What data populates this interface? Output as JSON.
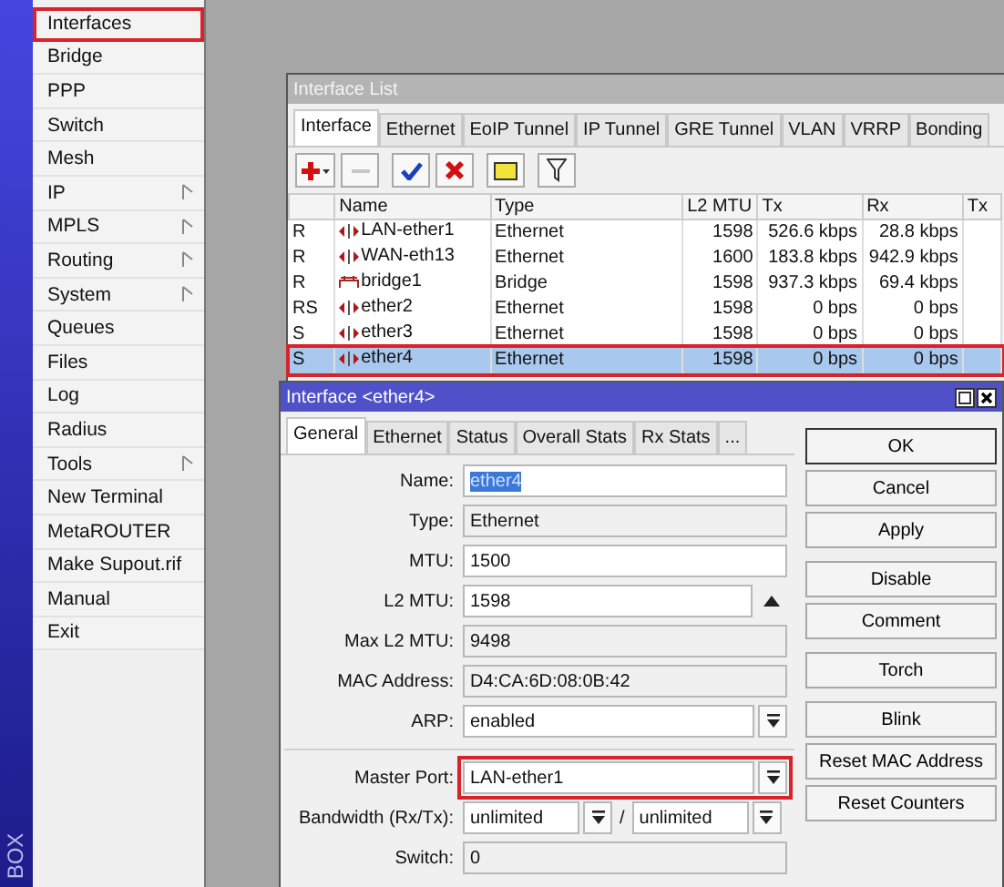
{
  "sidebar": {
    "brand": "BOX",
    "items": [
      {
        "label": "Interfaces",
        "submenu": false,
        "highlighted": true
      },
      {
        "label": "Bridge",
        "submenu": false,
        "highlighted": false
      },
      {
        "label": "PPP",
        "submenu": false,
        "highlighted": false
      },
      {
        "label": "Switch",
        "submenu": false,
        "highlighted": false
      },
      {
        "label": "Mesh",
        "submenu": false,
        "highlighted": false
      },
      {
        "label": "IP",
        "submenu": true,
        "highlighted": false
      },
      {
        "label": "MPLS",
        "submenu": true,
        "highlighted": false
      },
      {
        "label": "Routing",
        "submenu": true,
        "highlighted": false
      },
      {
        "label": "System",
        "submenu": true,
        "highlighted": false
      },
      {
        "label": "Queues",
        "submenu": false,
        "highlighted": false
      },
      {
        "label": "Files",
        "submenu": false,
        "highlighted": false
      },
      {
        "label": "Log",
        "submenu": false,
        "highlighted": false
      },
      {
        "label": "Radius",
        "submenu": false,
        "highlighted": false
      },
      {
        "label": "Tools",
        "submenu": true,
        "highlighted": false
      },
      {
        "label": "New Terminal",
        "submenu": false,
        "highlighted": false
      },
      {
        "label": "MetaROUTER",
        "submenu": false,
        "highlighted": false
      },
      {
        "label": "Make Supout.rif",
        "submenu": false,
        "highlighted": false
      },
      {
        "label": "Manual",
        "submenu": false,
        "highlighted": false
      },
      {
        "label": "Exit",
        "submenu": false,
        "highlighted": false
      }
    ]
  },
  "interface_list": {
    "title": "Interface List",
    "tabs": [
      {
        "label": "Interface",
        "selected": true
      },
      {
        "label": "Ethernet",
        "selected": false
      },
      {
        "label": "EoIP Tunnel",
        "selected": false
      },
      {
        "label": "IP Tunnel",
        "selected": false
      },
      {
        "label": "GRE Tunnel",
        "selected": false
      },
      {
        "label": "VLAN",
        "selected": false
      },
      {
        "label": "VRRP",
        "selected": false
      },
      {
        "label": "Bonding",
        "selected": false
      }
    ],
    "columns": [
      "",
      "Name",
      "Type",
      "L2 MTU",
      "Tx",
      "Rx",
      "Tx"
    ],
    "rows": [
      {
        "flags": "R",
        "kind": "ethernet",
        "name": "LAN-ether1",
        "type": "Ethernet",
        "l2_mtu": "1598",
        "tx": "526.6 kbps",
        "rx": "28.8 kbps",
        "selected": false,
        "highlighted": false
      },
      {
        "flags": "R",
        "kind": "ethernet",
        "name": "WAN-eth13",
        "type": "Ethernet",
        "l2_mtu": "1600",
        "tx": "183.8 kbps",
        "rx": "942.9 kbps",
        "selected": false,
        "highlighted": false
      },
      {
        "flags": "R",
        "kind": "bridge",
        "name": "bridge1",
        "type": "Bridge",
        "l2_mtu": "1598",
        "tx": "937.3 kbps",
        "rx": "69.4 kbps",
        "selected": false,
        "highlighted": false
      },
      {
        "flags": "RS",
        "kind": "ethernet",
        "name": "ether2",
        "type": "Ethernet",
        "l2_mtu": "1598",
        "tx": "0 bps",
        "rx": "0 bps",
        "selected": false,
        "highlighted": false
      },
      {
        "flags": "S",
        "kind": "ethernet",
        "name": "ether3",
        "type": "Ethernet",
        "l2_mtu": "1598",
        "tx": "0 bps",
        "rx": "0 bps",
        "selected": false,
        "highlighted": false
      },
      {
        "flags": "S",
        "kind": "ethernet",
        "name": "ether4",
        "type": "Ethernet",
        "l2_mtu": "1598",
        "tx": "0 bps",
        "rx": "0 bps",
        "selected": true,
        "highlighted": true
      }
    ]
  },
  "dialog": {
    "title": "Interface <ether4>",
    "tabs": [
      {
        "label": "General",
        "selected": true
      },
      {
        "label": "Ethernet",
        "selected": false
      },
      {
        "label": "Status",
        "selected": false
      },
      {
        "label": "Overall Stats",
        "selected": false
      },
      {
        "label": "Rx Stats",
        "selected": false
      },
      {
        "label": "...",
        "selected": false
      }
    ],
    "fields": [
      {
        "label": "Name:",
        "kind": "text",
        "value": "ether4",
        "value_selected": true,
        "highlighted": false,
        "separator_before": false
      },
      {
        "label": "Type:",
        "kind": "readonly",
        "value": "Ethernet",
        "value_selected": false,
        "highlighted": false,
        "separator_before": false
      },
      {
        "label": "MTU:",
        "kind": "text",
        "value": "1500",
        "value_selected": false,
        "highlighted": false,
        "separator_before": false
      },
      {
        "label": "L2 MTU:",
        "kind": "spin",
        "value": "1598",
        "value_selected": false,
        "highlighted": false,
        "separator_before": false
      },
      {
        "label": "Max L2 MTU:",
        "kind": "readonly",
        "value": "9498",
        "value_selected": false,
        "highlighted": false,
        "separator_before": false
      },
      {
        "label": "MAC Address:",
        "kind": "readonly",
        "value": "D4:CA:6D:08:0B:42",
        "value_selected": false,
        "highlighted": false,
        "separator_before": false
      },
      {
        "label": "ARP:",
        "kind": "dropdown",
        "value": "enabled",
        "value_selected": false,
        "highlighted": false,
        "separator_before": false
      },
      {
        "label": "Master Port:",
        "kind": "dropdown",
        "value": "LAN-ether1",
        "value_selected": false,
        "highlighted": true,
        "separator_before": true
      },
      {
        "label": "Bandwidth (Rx/Tx):",
        "kind": "pair",
        "value": "unlimited",
        "value2": "unlimited",
        "separator": "/",
        "value_selected": false,
        "highlighted": false,
        "separator_before": false
      },
      {
        "label": "Switch:",
        "kind": "readonly",
        "value": "0",
        "value_selected": false,
        "highlighted": false,
        "separator_before": false
      }
    ],
    "button_groups": [
      {
        "buttons": [
          {
            "label": "OK",
            "default": true
          },
          {
            "label": "Cancel",
            "default": false
          },
          {
            "label": "Apply",
            "default": false
          }
        ]
      },
      {
        "buttons": [
          {
            "label": "Disable",
            "default": false
          },
          {
            "label": "Comment",
            "default": false
          }
        ]
      },
      {
        "buttons": [
          {
            "label": "Torch",
            "default": false
          }
        ]
      },
      {
        "buttons": [
          {
            "label": "Blink",
            "default": false
          },
          {
            "label": "Reset MAC Address",
            "default": false
          },
          {
            "label": "Reset Counters",
            "default": false
          }
        ]
      }
    ]
  }
}
